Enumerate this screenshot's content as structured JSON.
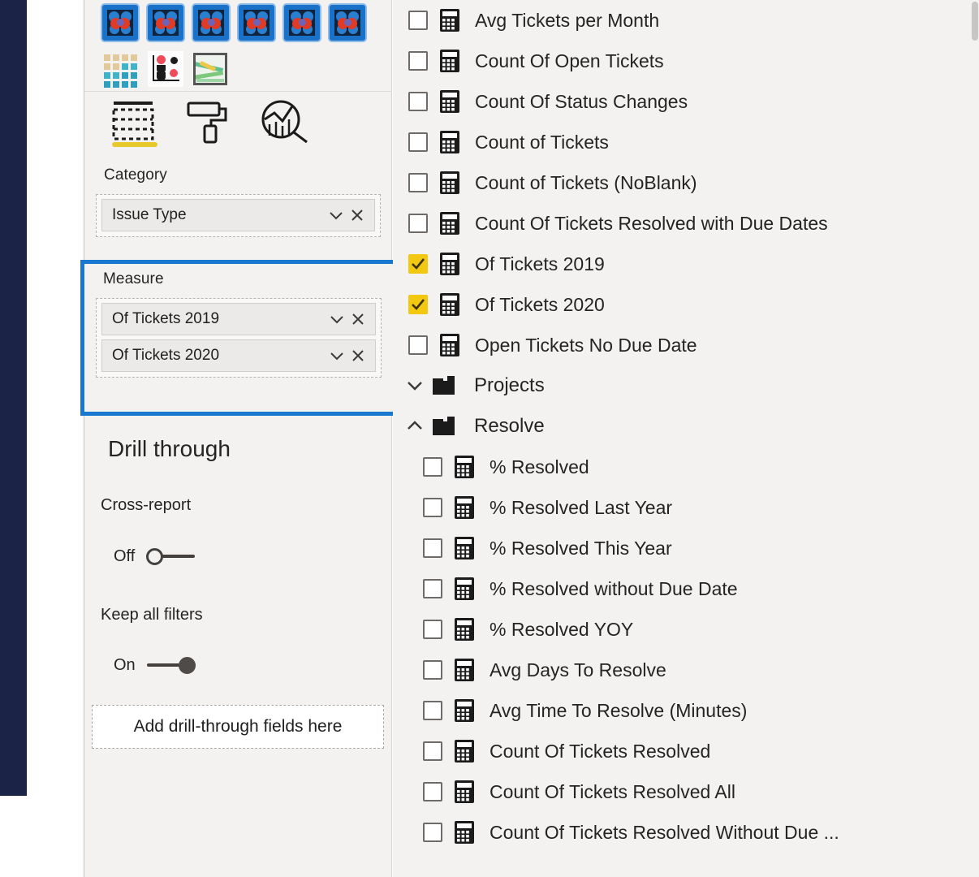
{
  "visualizations": {
    "gallery_row1_icons": [
      "custom-visual-1",
      "custom-visual-2",
      "custom-visual-3",
      "custom-visual-4",
      "custom-visual-5",
      "custom-visual-6"
    ],
    "gallery_row2_icons": [
      "grid-matrix-visual",
      "dot-plot-visual",
      "image-chart-visual"
    ],
    "tabs": [
      {
        "name": "fields",
        "icon": "fields-table-icon",
        "active": true
      },
      {
        "name": "format",
        "icon": "paint-roller-icon",
        "active": false
      },
      {
        "name": "analytics",
        "icon": "analytics-magnifier-icon",
        "active": false
      }
    ]
  },
  "wells": {
    "category": {
      "label": "Category",
      "fields": [
        {
          "name": "Issue Type",
          "dropdown_icon": "chevron-down-icon",
          "remove_icon": "close-icon"
        }
      ]
    },
    "measure": {
      "label": "Measure",
      "highlighted": true,
      "highlight_color": "#1878D0",
      "fields": [
        {
          "name": "Of Tickets 2019",
          "dropdown_icon": "chevron-down-icon",
          "remove_icon": "close-icon"
        },
        {
          "name": "Of Tickets 2020",
          "dropdown_icon": "chevron-down-icon",
          "remove_icon": "close-icon"
        }
      ]
    }
  },
  "drill_through": {
    "title": "Drill through",
    "cross_report": {
      "label": "Cross-report",
      "state": "Off",
      "on": false
    },
    "keep_all_filters": {
      "label": "Keep all filters",
      "state": "On",
      "on": true
    },
    "drop_placeholder": "Add drill-through fields here"
  },
  "fields_pane": {
    "accent_checked_color": "#F2C811",
    "items": [
      {
        "type": "measure",
        "label": "Avg Tickets per Month",
        "checked": false,
        "indent": "root"
      },
      {
        "type": "measure",
        "label": "Count Of Open Tickets",
        "checked": false,
        "indent": "root"
      },
      {
        "type": "measure",
        "label": "Count Of Status Changes",
        "checked": false,
        "indent": "root"
      },
      {
        "type": "measure",
        "label": "Count of Tickets",
        "checked": false,
        "indent": "root"
      },
      {
        "type": "measure",
        "label": "Count of Tickets (NoBlank)",
        "checked": false,
        "indent": "root"
      },
      {
        "type": "measure",
        "label": "Count Of Tickets Resolved with Due Dates",
        "checked": false,
        "indent": "root"
      },
      {
        "type": "measure",
        "label": "Of Tickets 2019",
        "checked": true,
        "indent": "root"
      },
      {
        "type": "measure",
        "label": "Of Tickets 2020",
        "checked": true,
        "indent": "root"
      },
      {
        "type": "measure",
        "label": "Open Tickets No Due Date",
        "checked": false,
        "indent": "root"
      },
      {
        "type": "folder",
        "label": "Projects",
        "expanded": false,
        "chevron": "chevron-down-icon"
      },
      {
        "type": "folder",
        "label": "Resolve",
        "expanded": true,
        "chevron": "chevron-up-icon"
      },
      {
        "type": "measure",
        "label": "% Resolved",
        "checked": false,
        "indent": "child"
      },
      {
        "type": "measure",
        "label": "% Resolved Last Year",
        "checked": false,
        "indent": "child"
      },
      {
        "type": "measure",
        "label": "% Resolved This Year",
        "checked": false,
        "indent": "child"
      },
      {
        "type": "measure",
        "label": "% Resolved without Due Date",
        "checked": false,
        "indent": "child"
      },
      {
        "type": "measure",
        "label": "% Resolved YOY",
        "checked": false,
        "indent": "child"
      },
      {
        "type": "measure",
        "label": "Avg Days To Resolve",
        "checked": false,
        "indent": "child"
      },
      {
        "type": "measure",
        "label": "Avg Time To Resolve (Minutes)",
        "checked": false,
        "indent": "child"
      },
      {
        "type": "measure",
        "label": "Count Of Tickets Resolved",
        "checked": false,
        "indent": "child"
      },
      {
        "type": "measure",
        "label": "Count Of Tickets Resolved All",
        "checked": false,
        "indent": "child"
      },
      {
        "type": "measure",
        "label": "Count Of Tickets Resolved Without Due ...",
        "checked": false,
        "indent": "child"
      }
    ]
  }
}
